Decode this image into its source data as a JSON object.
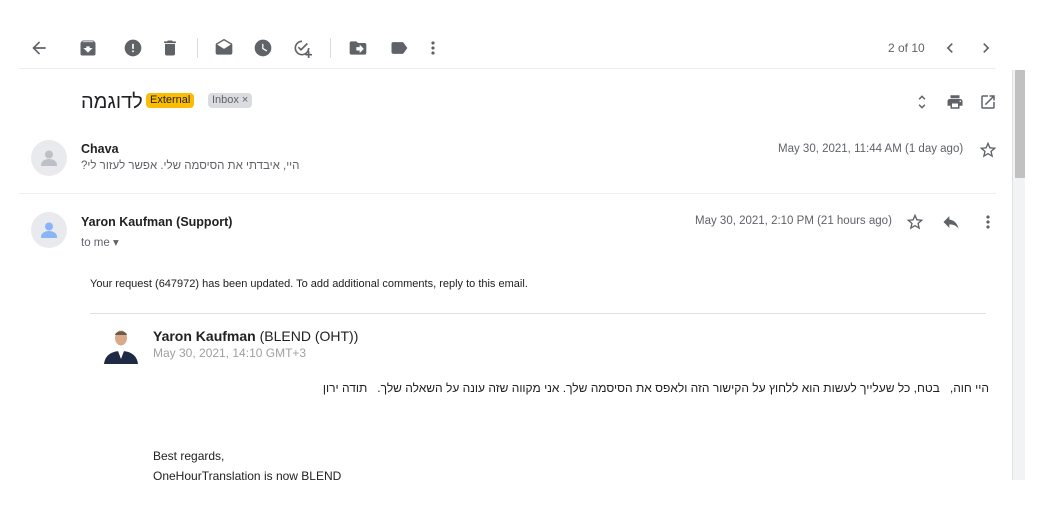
{
  "toolbar": {
    "buttons": [
      "back-icon",
      "archive-icon",
      "report-spam-icon",
      "delete-icon",
      "mark-unread-icon",
      "snooze-icon",
      "add-to-tasks-icon",
      "move-to-icon",
      "label-icon",
      "more-vert-icon"
    ],
    "pager": "2 of 10"
  },
  "thread": {
    "subject": "לדוגמה",
    "labels": {
      "external": "External",
      "inbox": "Inbox",
      "inbox_remove": "×"
    }
  },
  "messages": [
    {
      "sender": "Chava",
      "snippet": "היי, איבדתי את הסיסמה שלי. אפשר לעזור לי?",
      "date": "May 30, 2021, 11:44 AM (1 day ago)"
    },
    {
      "sender": "Yaron Kaufman (Support)",
      "to": "to me ▾",
      "date": "May 30, 2021, 2:10 PM (21 hours ago)",
      "body": "Your request (647972) has been updated. To add additional comments, reply to this email.",
      "quoted": {
        "name": "Yaron Kaufman",
        "org": "(BLEND (OHT))",
        "date": "May 30, 2021, 14:10 GMT+3",
        "text": "היי חוה,   בטח, כל שעלייך לעשות הוא ללחוץ על הקישור הזה ולאפס את הסיסמה שלך. אני מקווה שזה עונה על השאלה שלך.   תודה ירון",
        "regards": "Best regards,",
        "signature": "OneHourTranslation is now BLEND"
      }
    }
  ],
  "colors": {
    "external_tag": "#fbbc04",
    "inbox_tag": "#dadce0",
    "icon": "#5f6368"
  }
}
